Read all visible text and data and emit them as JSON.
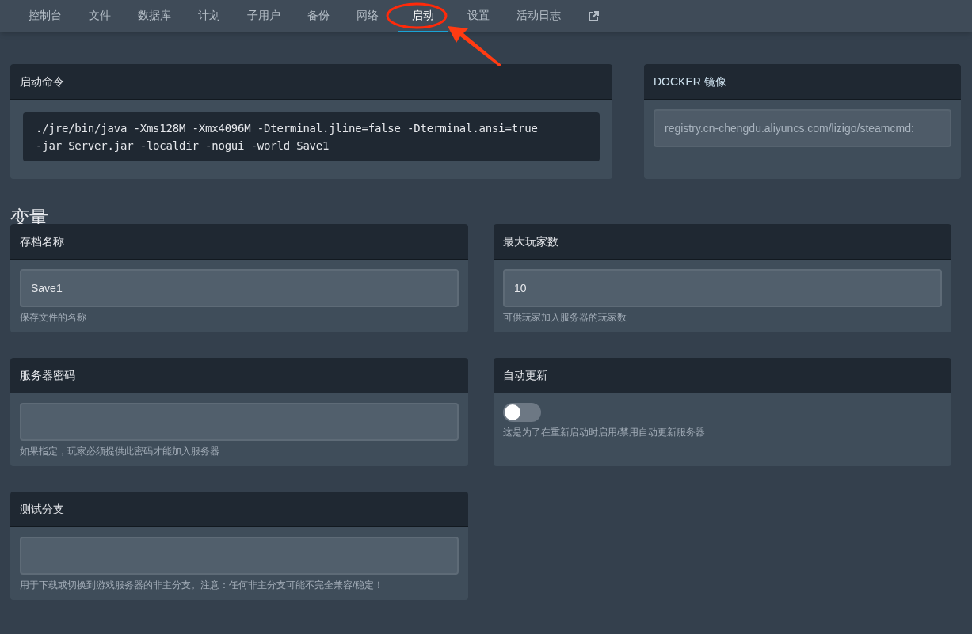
{
  "nav": {
    "tabs": [
      {
        "label": "控制台",
        "selected": false,
        "highlighted": false
      },
      {
        "label": "文件",
        "selected": false,
        "highlighted": false
      },
      {
        "label": "数据库",
        "selected": false,
        "highlighted": false
      },
      {
        "label": "计划",
        "selected": false,
        "highlighted": false
      },
      {
        "label": "子用户",
        "selected": false,
        "highlighted": false
      },
      {
        "label": "备份",
        "selected": false,
        "highlighted": false
      },
      {
        "label": "网络",
        "selected": false,
        "highlighted": false
      },
      {
        "label": "启动",
        "selected": true,
        "highlighted": true
      },
      {
        "label": "设置",
        "selected": false,
        "highlighted": false
      },
      {
        "label": "活动日志",
        "selected": false,
        "highlighted": false
      }
    ]
  },
  "startup_command": {
    "title": "启动命令",
    "lines": [
      "./jre/bin/java -Xms128M -Xmx4096M -Dterminal.jline=false -Dterminal.ansi=true",
      "-jar Server.jar -localdir -nogui -world Save1"
    ]
  },
  "docker_image": {
    "title": "DOCKER 镜像",
    "value": "registry.cn-chengdu.aliyuncs.com/lizigo/steamcmd:"
  },
  "variables": {
    "heading": "变量",
    "items": [
      {
        "kind": "text",
        "title": "存档名称",
        "value": "Save1",
        "help": "保存文件的名称"
      },
      {
        "kind": "text",
        "title": "最大玩家数",
        "value": "10",
        "help": "可供玩家加入服务器的玩家数"
      },
      {
        "kind": "text",
        "title": "服务器密码",
        "help": "如果指定，玩家必须提供此密码才能加入服务器"
      },
      {
        "kind": "toggle",
        "title": "自动更新",
        "on": false,
        "help": "这是为了在重新启动时启用/禁用自动更新服务器"
      },
      {
        "kind": "text",
        "title": "测试分支",
        "help": "用于下载或切换到游戏服务器的非主分支。注意：任何非主分支可能不完全兼容/稳定！"
      }
    ]
  }
}
